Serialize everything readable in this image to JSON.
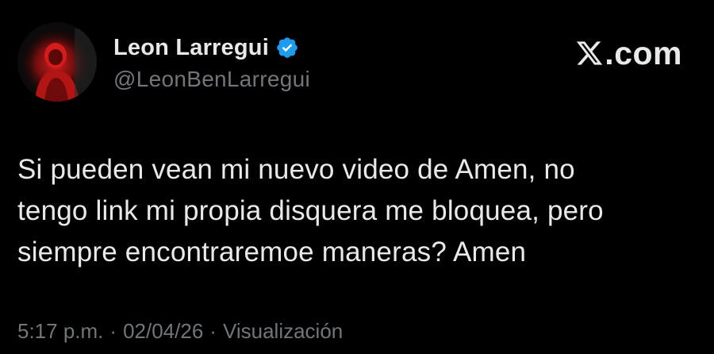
{
  "author": {
    "display_name": "Leon Larregui",
    "handle": "@LeonBenLarregui",
    "verified": true,
    "verified_color": "#1d9bf0"
  },
  "brand": {
    "text": ".com",
    "icon": "x-logo-icon"
  },
  "tweet": {
    "lines": [
      "Si pueden vean mi nuevo video de Amen, no",
      "tengo link mi propia disquera me bloquea, pero",
      "siempre encontraremoe maneras? Amen"
    ]
  },
  "meta": {
    "time": "5:17 p.m.",
    "separator": "·",
    "date": "02/04/26",
    "views_label": "Visualización"
  },
  "colors": {
    "background": "#000000",
    "primary_text": "#e7e9ea",
    "secondary_text": "#71767b",
    "avatar_accent": "#c01818"
  }
}
